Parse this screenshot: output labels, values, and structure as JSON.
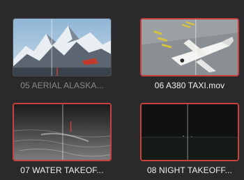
{
  "media_pool": {
    "clips": [
      {
        "name": "05 AERIAL  ALASKA...",
        "selected": false,
        "badge": ""
      },
      {
        "name": "06 A380 TAXI.mov",
        "selected": true,
        "badge": "music-note-icon"
      },
      {
        "name": "07 WATER TAKEOF...",
        "selected": true,
        "badge": "music-note-icon"
      },
      {
        "name": "08 NIGHT TAKEOFF...",
        "selected": true,
        "badge": "subtitle-icon"
      }
    ]
  },
  "colors": {
    "selection_border": "#c9403c",
    "background": "#2a2a2c"
  }
}
